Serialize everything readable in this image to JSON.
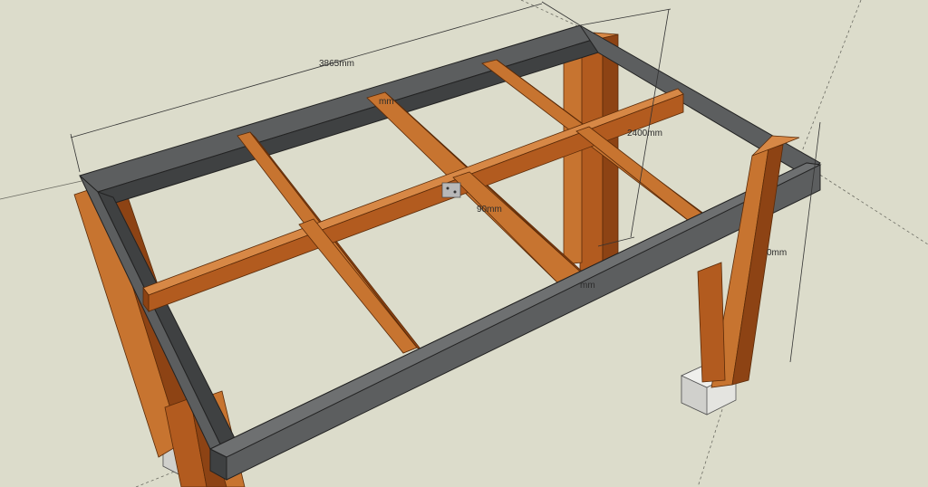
{
  "dimensions": {
    "length": "3865mm",
    "width": "2400mm",
    "joist_width": "90mm",
    "label_partial_top": "mm",
    "label_partial_bottom": "mm",
    "label_partial_right": "0mm"
  },
  "colors": {
    "background": "#dcdccb",
    "steel_frame": "#5c5e5f",
    "steel_frame_dark": "#3f4142",
    "timber": "#b25b1f",
    "timber_light": "#c77430",
    "timber_dark": "#8d4314",
    "concrete": "#dcdcd8",
    "dimension_line": "#333333"
  }
}
